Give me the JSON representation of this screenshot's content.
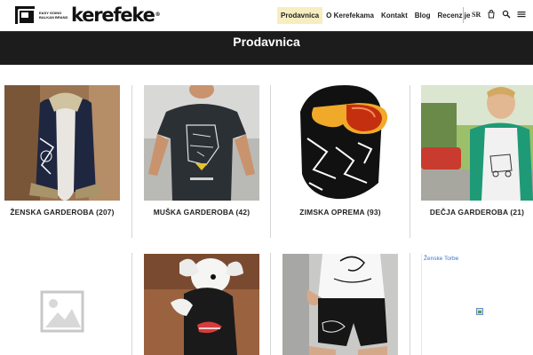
{
  "brand": {
    "name": "kerefeke",
    "reg": "®",
    "tagline": "Easy going Balkan brand"
  },
  "nav": {
    "items": [
      {
        "label": "Prodavnica",
        "active": true
      },
      {
        "label": "O Kerefekama",
        "active": false
      },
      {
        "label": "Kontakt",
        "active": false
      },
      {
        "label": "Blog",
        "active": false
      },
      {
        "label": "Recenzije",
        "active": false
      }
    ],
    "lang": "SR",
    "icons": [
      "cart-icon",
      "search-icon",
      "menu-icon"
    ]
  },
  "hero": {
    "title": "Prodavnica"
  },
  "categories": [
    {
      "label": "ŽENSKA GARDEROBA (207)"
    },
    {
      "label": "MUŠKA GARDEROBA (42)"
    },
    {
      "label": "ZIMSKA OPREMA (93)"
    },
    {
      "label": "DEČJA GARDEROBA (21)"
    },
    {
      "label": ""
    },
    {
      "label": ""
    },
    {
      "label": ""
    },
    {
      "label": "Ženske Torbe"
    }
  ],
  "colors": {
    "header_bg": "#ffffff",
    "hero_bg": "#1c1c1c",
    "active_nav_bg": "#f6eec0",
    "link_blue": "#3a78c8"
  }
}
